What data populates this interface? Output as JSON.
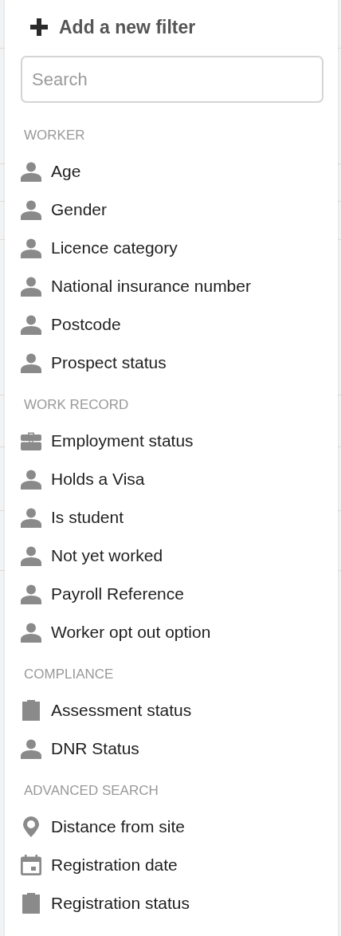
{
  "header": {
    "label": "Add a new filter"
  },
  "search": {
    "placeholder": "Search"
  },
  "sections": [
    {
      "title": "WORKER",
      "items": [
        {
          "label": "Age",
          "kind": "person"
        },
        {
          "label": "Gender",
          "kind": "person"
        },
        {
          "label": "Licence category",
          "kind": "person"
        },
        {
          "label": "National insurance number",
          "kind": "person"
        },
        {
          "label": "Postcode",
          "kind": "person"
        },
        {
          "label": "Prospect status",
          "kind": "person"
        }
      ]
    },
    {
      "title": "WORK RECORD",
      "items": [
        {
          "label": "Employment status",
          "kind": "briefcase"
        },
        {
          "label": "Holds a Visa",
          "kind": "person"
        },
        {
          "label": "Is student",
          "kind": "person"
        },
        {
          "label": "Not yet worked",
          "kind": "person"
        },
        {
          "label": "Payroll Reference",
          "kind": "person"
        },
        {
          "label": "Worker opt out option",
          "kind": "person"
        }
      ]
    },
    {
      "title": "COMPLIANCE",
      "items": [
        {
          "label": "Assessment status",
          "kind": "clipboard"
        },
        {
          "label": "DNR Status",
          "kind": "person"
        }
      ]
    },
    {
      "title": "ADVANCED SEARCH",
      "items": [
        {
          "label": "Distance from site",
          "kind": "pin"
        },
        {
          "label": "Registration date",
          "kind": "calendar"
        },
        {
          "label": "Registration status",
          "kind": "clipboard"
        }
      ]
    }
  ]
}
